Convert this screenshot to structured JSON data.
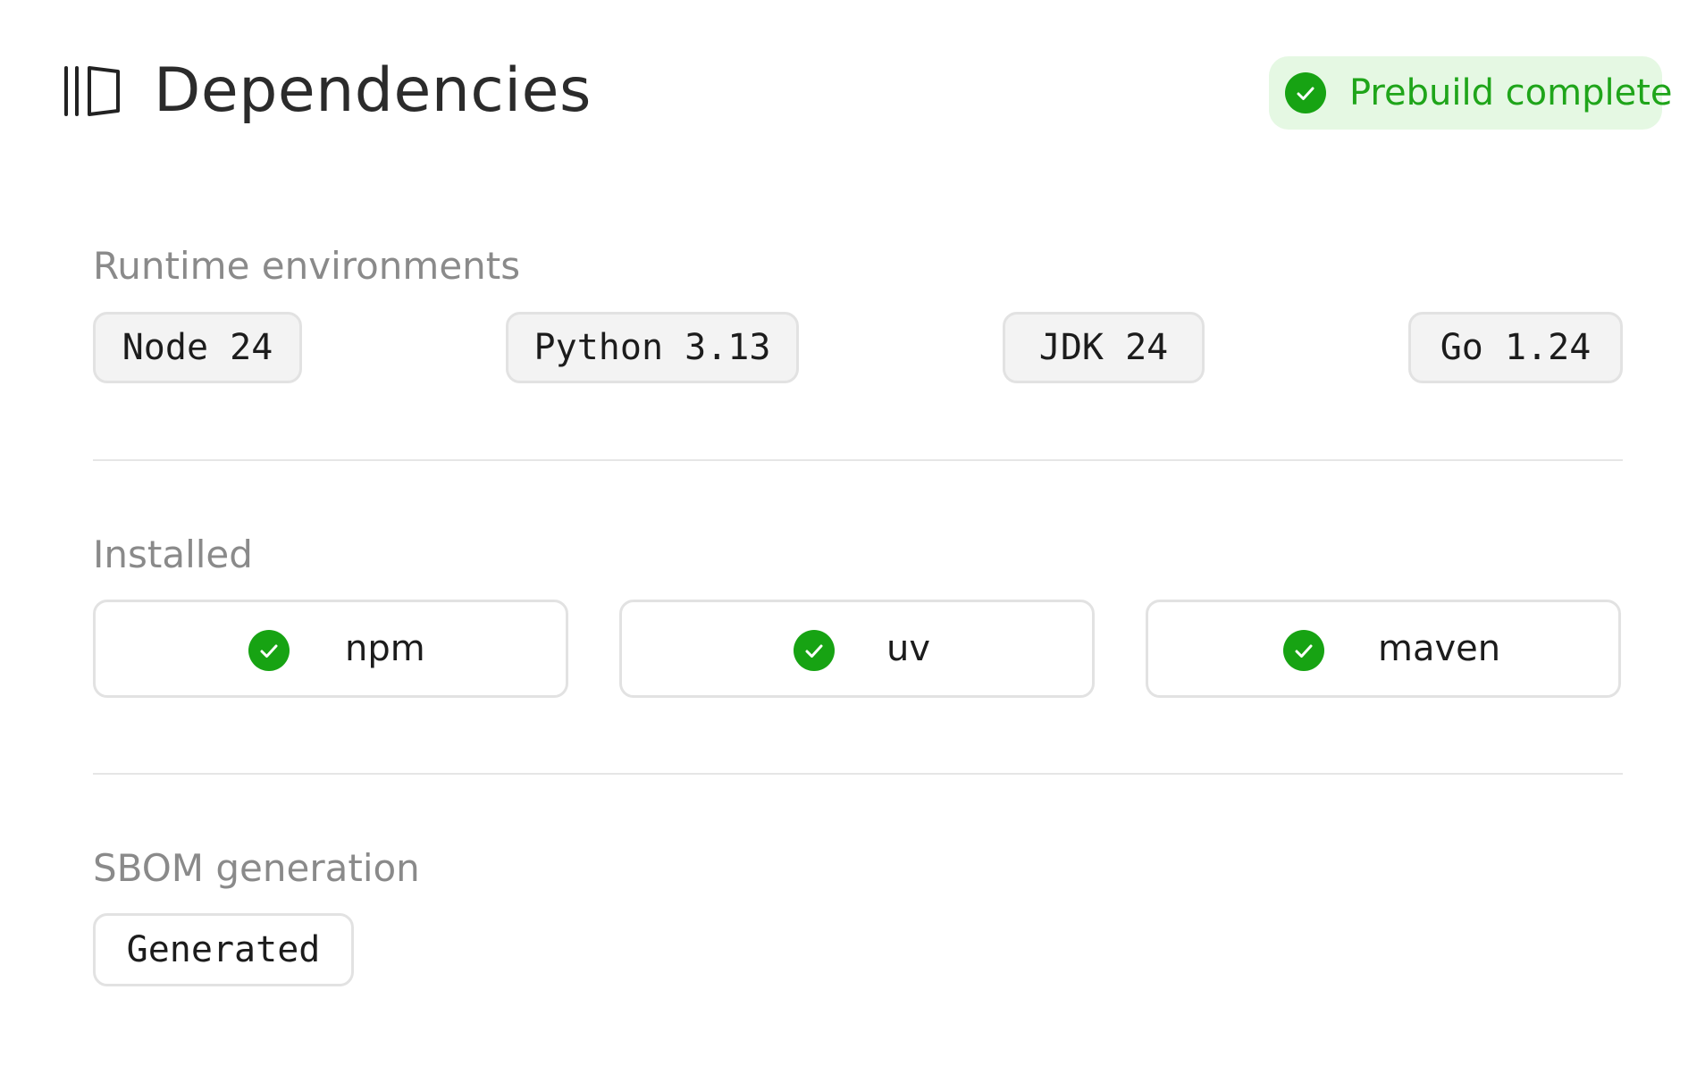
{
  "header": {
    "title": "Dependencies",
    "icon": "dependencies-icon",
    "status": {
      "label": "Prebuild complete",
      "icon": "check-circle-icon",
      "color": "#17a313",
      "background": "#e5f8e3"
    }
  },
  "runtime": {
    "label": "Runtime environments",
    "items": [
      {
        "label": "Node 24"
      },
      {
        "label": "Python 3.13"
      },
      {
        "label": "JDK 24"
      },
      {
        "label": "Go 1.24"
      }
    ]
  },
  "installed": {
    "label": "Installed",
    "items": [
      {
        "name": "npm",
        "icon": "check-circle-icon"
      },
      {
        "name": "uv",
        "icon": "check-circle-icon"
      },
      {
        "name": "maven",
        "icon": "check-circle-icon"
      }
    ]
  },
  "sbom": {
    "label": "SBOM generation",
    "status": "Generated"
  },
  "colors": {
    "success": "#17a313",
    "success_text": "#1fa51a",
    "muted_text": "#8a8a8a",
    "border": "#e2e2e2"
  }
}
